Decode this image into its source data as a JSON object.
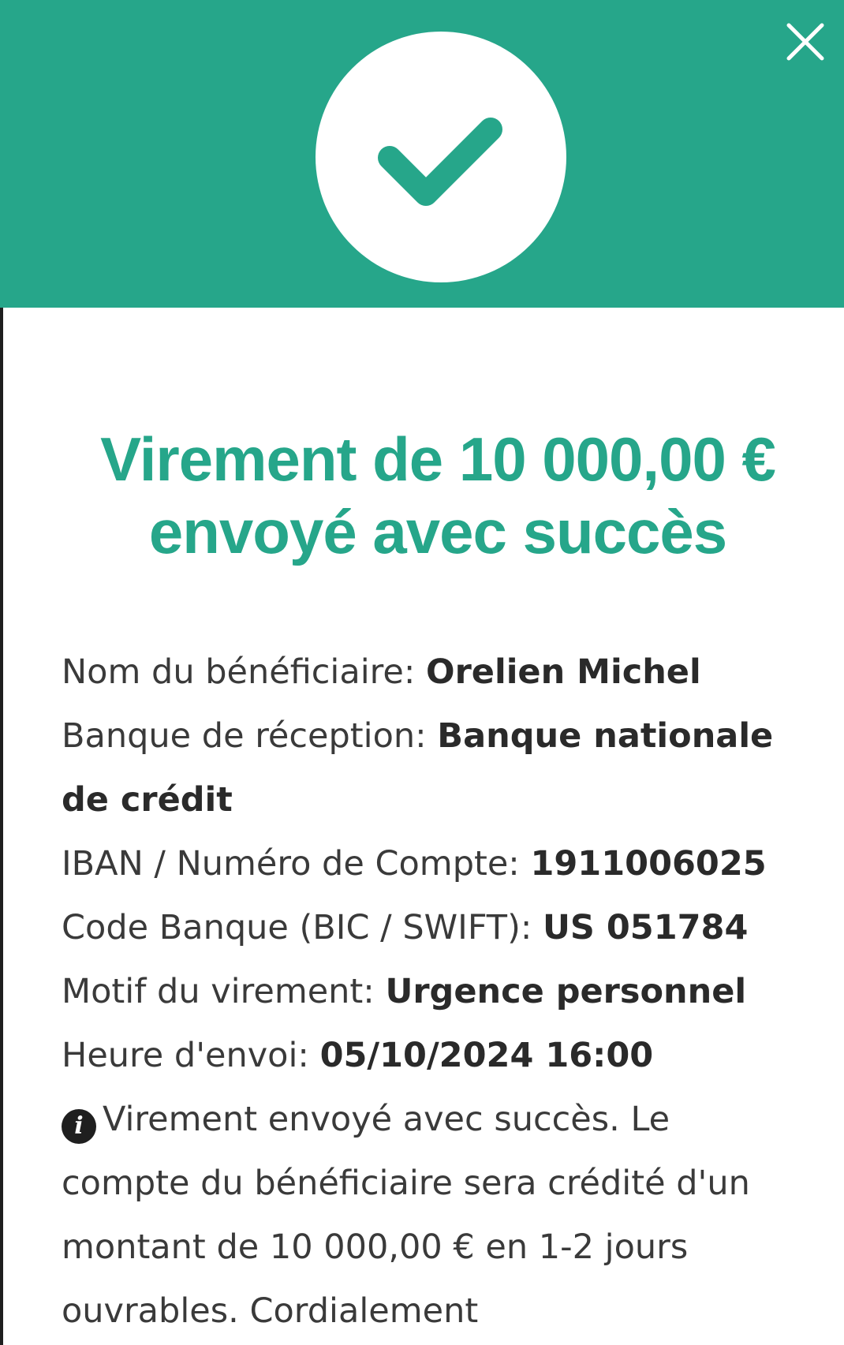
{
  "header": {
    "background_color": "#26a68a",
    "success_icon": "check-icon",
    "close_icon": "close-icon"
  },
  "title": "Virement de 10 000,00 € envoyé avec succès",
  "details": [
    {
      "label": "Nom du bénéficiaire: ",
      "value": "Orelien Michel"
    },
    {
      "label": "Banque de réception: ",
      "value": "Banque nationale de crédit"
    },
    {
      "label": "IBAN / Numéro de Compte: ",
      "value": "1911006025"
    },
    {
      "label": "Code Banque (BIC / SWIFT): ",
      "value": "US 051784"
    },
    {
      "label": "Motif du virement: ",
      "value": "Urgence personnel"
    },
    {
      "label": "Heure d'envoi: ",
      "value": "05/10/2024 16:00"
    }
  ],
  "info": {
    "icon": "info-icon",
    "icon_glyph": "i",
    "text": "Virement envoyé avec succès. Le compte du bénéficiaire sera crédité d'un montant de 10 000,00 € en 1-2 jours ouvrables. Cordialement"
  }
}
